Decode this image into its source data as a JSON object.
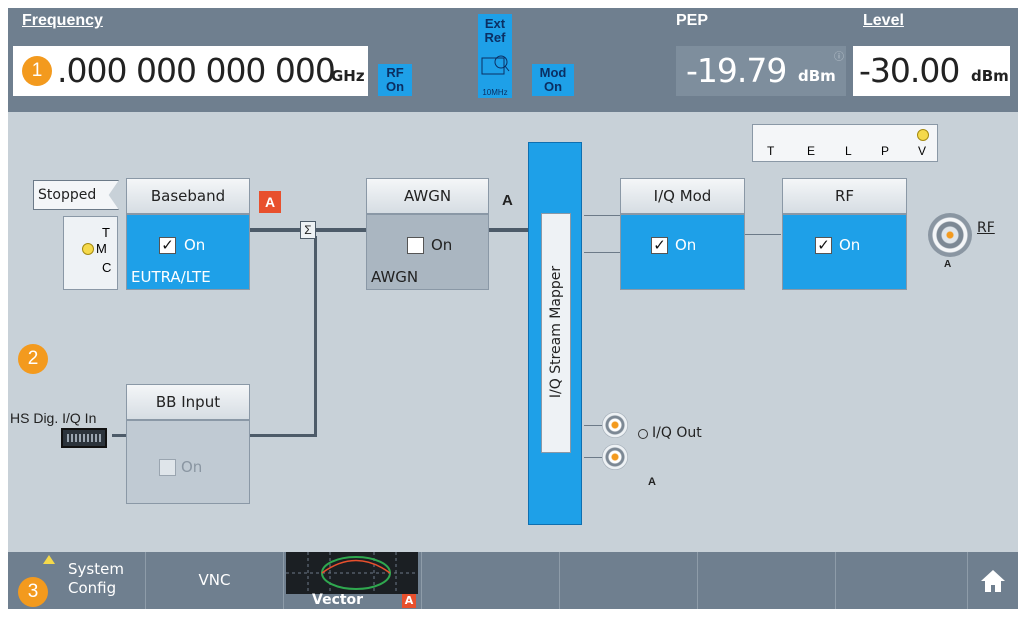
{
  "header": {
    "frequency": {
      "label": "Frequency",
      "value": ".000 000 000 000",
      "unit": "GHz"
    },
    "rf_chip": {
      "line1": "RF",
      "line2": "On"
    },
    "ext_ref": {
      "line1": "Ext",
      "line2": "Ref",
      "sub": "10MHz"
    },
    "mod_chip": {
      "line1": "Mod",
      "line2": "On"
    },
    "pep": {
      "label": "PEP",
      "value": "-19.79",
      "unit": "dBm"
    },
    "level": {
      "label": "Level",
      "value": "-30.00",
      "unit": "dBm"
    }
  },
  "badges": {
    "one": "1",
    "two": "2",
    "three": "3"
  },
  "diagram": {
    "stopped": "Stopped",
    "tmc": {
      "t": "T",
      "m": "M",
      "c": "C"
    },
    "baseband": {
      "title": "Baseband",
      "check": "On",
      "sub": "EUTRA/LTE",
      "tag": "A"
    },
    "sum_symbol": "Σ",
    "awgn": {
      "title": "AWGN",
      "check": "On",
      "sub": "AWGN",
      "tag": "A"
    },
    "mapper": "I/Q Stream Mapper",
    "iqmod": {
      "title": "I/Q Mod",
      "check": "On"
    },
    "rf_block": {
      "title": "RF",
      "check": "On"
    },
    "rf_output": {
      "label": "RF",
      "tag": "A"
    },
    "telpv": {
      "t": "T",
      "e": "E",
      "l": "L",
      "p": "P",
      "v": "V"
    },
    "hs_dig": "HS Dig. I/Q In",
    "bbinput": {
      "title": "BB Input",
      "check": "On"
    },
    "iq_out": {
      "label": "I/Q Out",
      "tag": "A"
    }
  },
  "taskbar": {
    "system_config": {
      "line1": "System",
      "line2": "Config"
    },
    "vnc": "VNC",
    "vector": {
      "label": "Vector",
      "tag": "A"
    }
  },
  "colors": {
    "accent_blue": "#1ea0e8",
    "badge_orange": "#f39a1e",
    "header_grey": "#6f7f8f",
    "tag_red": "#e8502d"
  }
}
